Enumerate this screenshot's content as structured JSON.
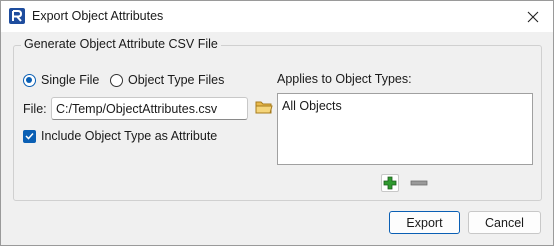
{
  "window": {
    "title": "Export Object Attributes"
  },
  "group": {
    "title": "Generate Object Attribute CSV File",
    "radio_single": {
      "label": "Single File",
      "checked": true
    },
    "radio_type": {
      "label": "Object Type Files",
      "checked": false
    },
    "file_label": "File:",
    "file_value": "C:/Temp/ObjectAttributes.csv",
    "include_type": {
      "label": "Include Object Type as Attribute",
      "checked": true
    },
    "applies_label": "Applies to Object Types:",
    "applies_items": [
      "All Objects"
    ]
  },
  "buttons": {
    "export": "Export",
    "cancel": "Cancel"
  },
  "colors": {
    "accent": "#0a5fb4",
    "add_green": "#2f9a2f"
  },
  "icons": {
    "app": "riverware-logo-icon",
    "folder": "folder-icon",
    "add": "plus-icon",
    "remove": "minus-icon",
    "close": "close-icon"
  }
}
